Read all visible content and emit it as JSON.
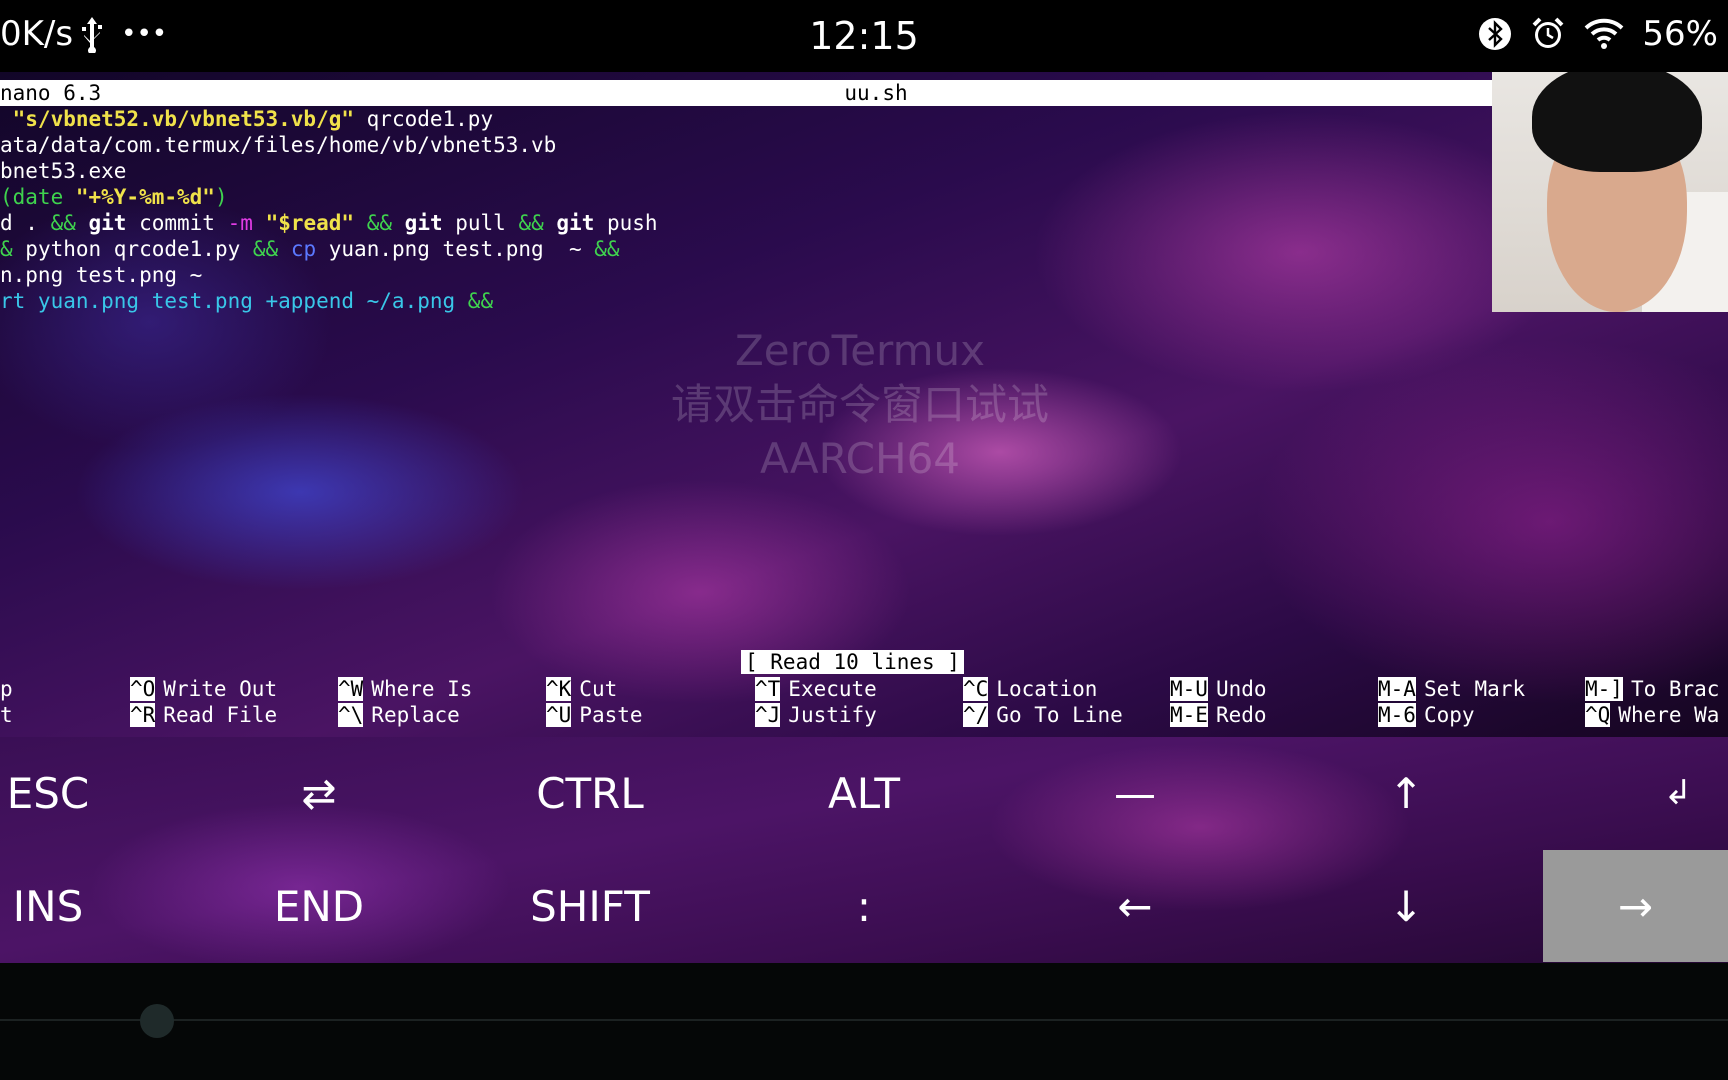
{
  "status_bar": {
    "net_speed": "0K/s",
    "more": "•••",
    "time": "12:15",
    "battery": "56%"
  },
  "nano": {
    "app": "nano 6.3",
    "filename": "uu.sh",
    "read_message": "[ Read 10 lines ]"
  },
  "code_lines": [
    [
      {
        "t": " \"s/vbnet52.vb/vbnet53.vb/g\"",
        "c": "c-y"
      },
      {
        "t": " qrcode1.py",
        "c": ""
      }
    ],
    [
      {
        "t": "ata/data/com.termux/files/home/vb/vbnet53.vb",
        "c": ""
      }
    ],
    [
      {
        "t": "bnet53.exe",
        "c": ""
      }
    ],
    [
      {
        "t": "(date ",
        "c": "c-g"
      },
      {
        "t": "\"+%Y-%m-%d\"",
        "c": "c-y"
      },
      {
        "t": ")",
        "c": "c-g"
      }
    ],
    [
      {
        "t": "d . ",
        "c": ""
      },
      {
        "t": "&&",
        "c": "c-g"
      },
      {
        "t": " git",
        "c": "c-w"
      },
      {
        "t": " commit ",
        "c": ""
      },
      {
        "t": "-m",
        "c": "c-m"
      },
      {
        "t": " ",
        "c": ""
      },
      {
        "t": "\"$read\"",
        "c": "c-y"
      },
      {
        "t": " ",
        "c": ""
      },
      {
        "t": "&&",
        "c": "c-g"
      },
      {
        "t": " git",
        "c": "c-w"
      },
      {
        "t": " pull ",
        "c": ""
      },
      {
        "t": "&&",
        "c": "c-g"
      },
      {
        "t": " git",
        "c": "c-w"
      },
      {
        "t": " push",
        "c": ""
      }
    ],
    [
      {
        "t": "&",
        "c": "c-g"
      },
      {
        "t": " python qrcode1.py ",
        "c": ""
      },
      {
        "t": "&&",
        "c": "c-g"
      },
      {
        "t": " ",
        "c": ""
      },
      {
        "t": "cp",
        "c": "c-b"
      },
      {
        "t": " yuan.png test.png  ~ ",
        "c": ""
      },
      {
        "t": "&&",
        "c": "c-g"
      }
    ],
    [
      {
        "t": "n.png test.png ~",
        "c": ""
      }
    ],
    [
      {
        "t": "rt yuan.png test.png +append ~/a.png ",
        "c": "c-c"
      },
      {
        "t": "&&",
        "c": "c-g"
      }
    ]
  ],
  "watermark": {
    "line1": "ZeroTermux",
    "line2": "请双击命令窗口试试",
    "line3": "AARCH64"
  },
  "shortcuts": [
    {
      "key": "^O",
      "label": "Write Out"
    },
    {
      "key": "^W",
      "label": "Where Is"
    },
    {
      "key": "^K",
      "label": "Cut"
    },
    {
      "key": "^T",
      "label": "Execute"
    },
    {
      "key": "^C",
      "label": "Location"
    },
    {
      "key": "M-U",
      "label": "Undo"
    },
    {
      "key": "M-A",
      "label": "Set Mark"
    },
    {
      "key": "M-]",
      "label": "To Brac"
    },
    {
      "key": "^R",
      "label": "Read File"
    },
    {
      "key": "^\\",
      "label": "Replace"
    },
    {
      "key": "^U",
      "label": "Paste"
    },
    {
      "key": "^J",
      "label": "Justify"
    },
    {
      "key": "^/",
      "label": "Go To Line"
    },
    {
      "key": "M-E",
      "label": "Redo"
    },
    {
      "key": "M-6",
      "label": "Copy"
    },
    {
      "key": "^Q",
      "label": "Where Wa"
    }
  ],
  "shortcut_cutoff": {
    "top": "p",
    "bottom": "t"
  },
  "extra_keys": {
    "row1": [
      "ESC",
      "⇄",
      "CTRL",
      "ALT",
      "—",
      "↑",
      "↲"
    ],
    "row2": [
      "INS",
      "END",
      "SHIFT",
      ":",
      "←",
      "↓",
      "→"
    ]
  },
  "colors": {
    "accent_yellow": "#f0e24a",
    "accent_green": "#3fd34e",
    "accent_magenta": "#e23ce6",
    "accent_blue": "#5b78ff",
    "accent_cyan": "#39c7e8",
    "active_key": "#9a9a9a"
  }
}
